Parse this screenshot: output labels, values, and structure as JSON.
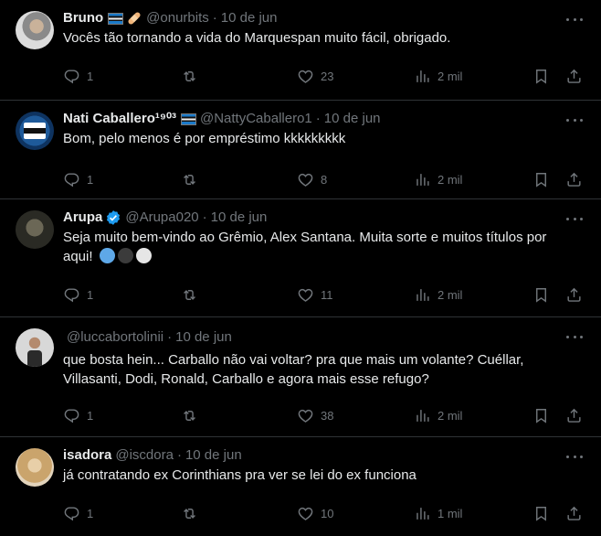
{
  "tweets": [
    {
      "name": "Bruno",
      "handle": "@onurbits",
      "time": "10 de jun",
      "text": "Vocês tão tornando a vida do Marquespan muito fácil, obrigado.",
      "replies": "1",
      "retweets": "",
      "likes": "23",
      "views": "2 mil"
    },
    {
      "name": "Nati Caballero¹⁹⁰³",
      "handle": "@NattyCaballero1",
      "time": "10 de jun",
      "text": "Bom, pelo menos é por empréstimo kkkkkkkkk",
      "replies": "1",
      "retweets": "",
      "likes": "8",
      "views": "2 mil"
    },
    {
      "name": "Arupa",
      "handle": "@Arupa020",
      "time": "10 de jun",
      "text": "Seja muito bem-vindo ao Grêmio, Alex Santana. Muita sorte e muitos títulos por aqui!",
      "replies": "1",
      "retweets": "",
      "likes": "11",
      "views": "2 mil"
    },
    {
      "name": "",
      "handle": "@luccabortolinii",
      "time": "10 de jun",
      "text": "que bosta hein... Carballo não vai voltar? pra que mais um volante? Cuéllar, Villasanti, Dodi, Ronald, Carballo e agora mais esse refugo?",
      "replies": "1",
      "retweets": "",
      "likes": "38",
      "views": "2 mil"
    },
    {
      "name": "isadora",
      "handle": "@iscdora",
      "time": "10 de jun",
      "text": "já contratando ex Corinthians pra ver se lei do ex funciona",
      "replies": "1",
      "retweets": "",
      "likes": "10",
      "views": "1 mil"
    }
  ],
  "colors": {
    "background": "#000000",
    "text": "#e7e9ea",
    "muted": "#71767b",
    "divider": "#2f3336",
    "verified": "#1d9bf0"
  },
  "icons": [
    "reply-icon",
    "retweet-icon",
    "like-icon",
    "views-icon",
    "bookmark-icon",
    "share-icon",
    "more-icon",
    "verified-icon",
    "flag-icon"
  ]
}
